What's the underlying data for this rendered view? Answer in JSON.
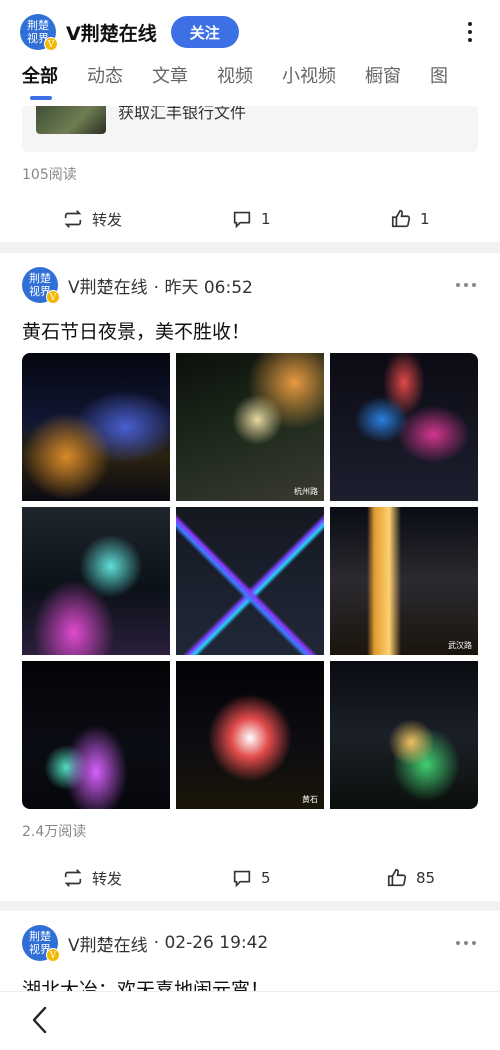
{
  "header": {
    "avatar_line1": "荆楚",
    "avatar_line2": "视界",
    "verified_badge": "V",
    "name": "V荆楚在线",
    "follow_label": "关注"
  },
  "tabs": [
    "全部",
    "动态",
    "文章",
    "视频",
    "小视频",
    "橱窗",
    "图"
  ],
  "active_tab": "全部",
  "accent_color": "#3d6fe5",
  "post1": {
    "link_title": "获取汇丰银行文件",
    "reads": "105阅读",
    "repost_label": "转发",
    "comments": "1",
    "likes": "1"
  },
  "post2": {
    "author": "V荆楚在线",
    "time": "· 昨天 06:52",
    "text": "黄石节日夜景，美不胜收！",
    "image_captions": [
      "",
      "杭州路",
      "",
      "",
      "",
      "武汉路",
      "",
      "黄石",
      ""
    ],
    "reads": "2.4万阅读",
    "repost_label": "转发",
    "comments": "5",
    "likes": "85"
  },
  "post3": {
    "author": "V荆楚在线",
    "time": "· 02-26 19:42",
    "text": "湖北大冶：欢天喜地闹元宵！"
  },
  "icons": {
    "back": "chevron-left-icon",
    "more": "more-dots-icon",
    "repost": "repost-icon",
    "comment": "comment-icon",
    "like": "thumb-up-icon"
  }
}
